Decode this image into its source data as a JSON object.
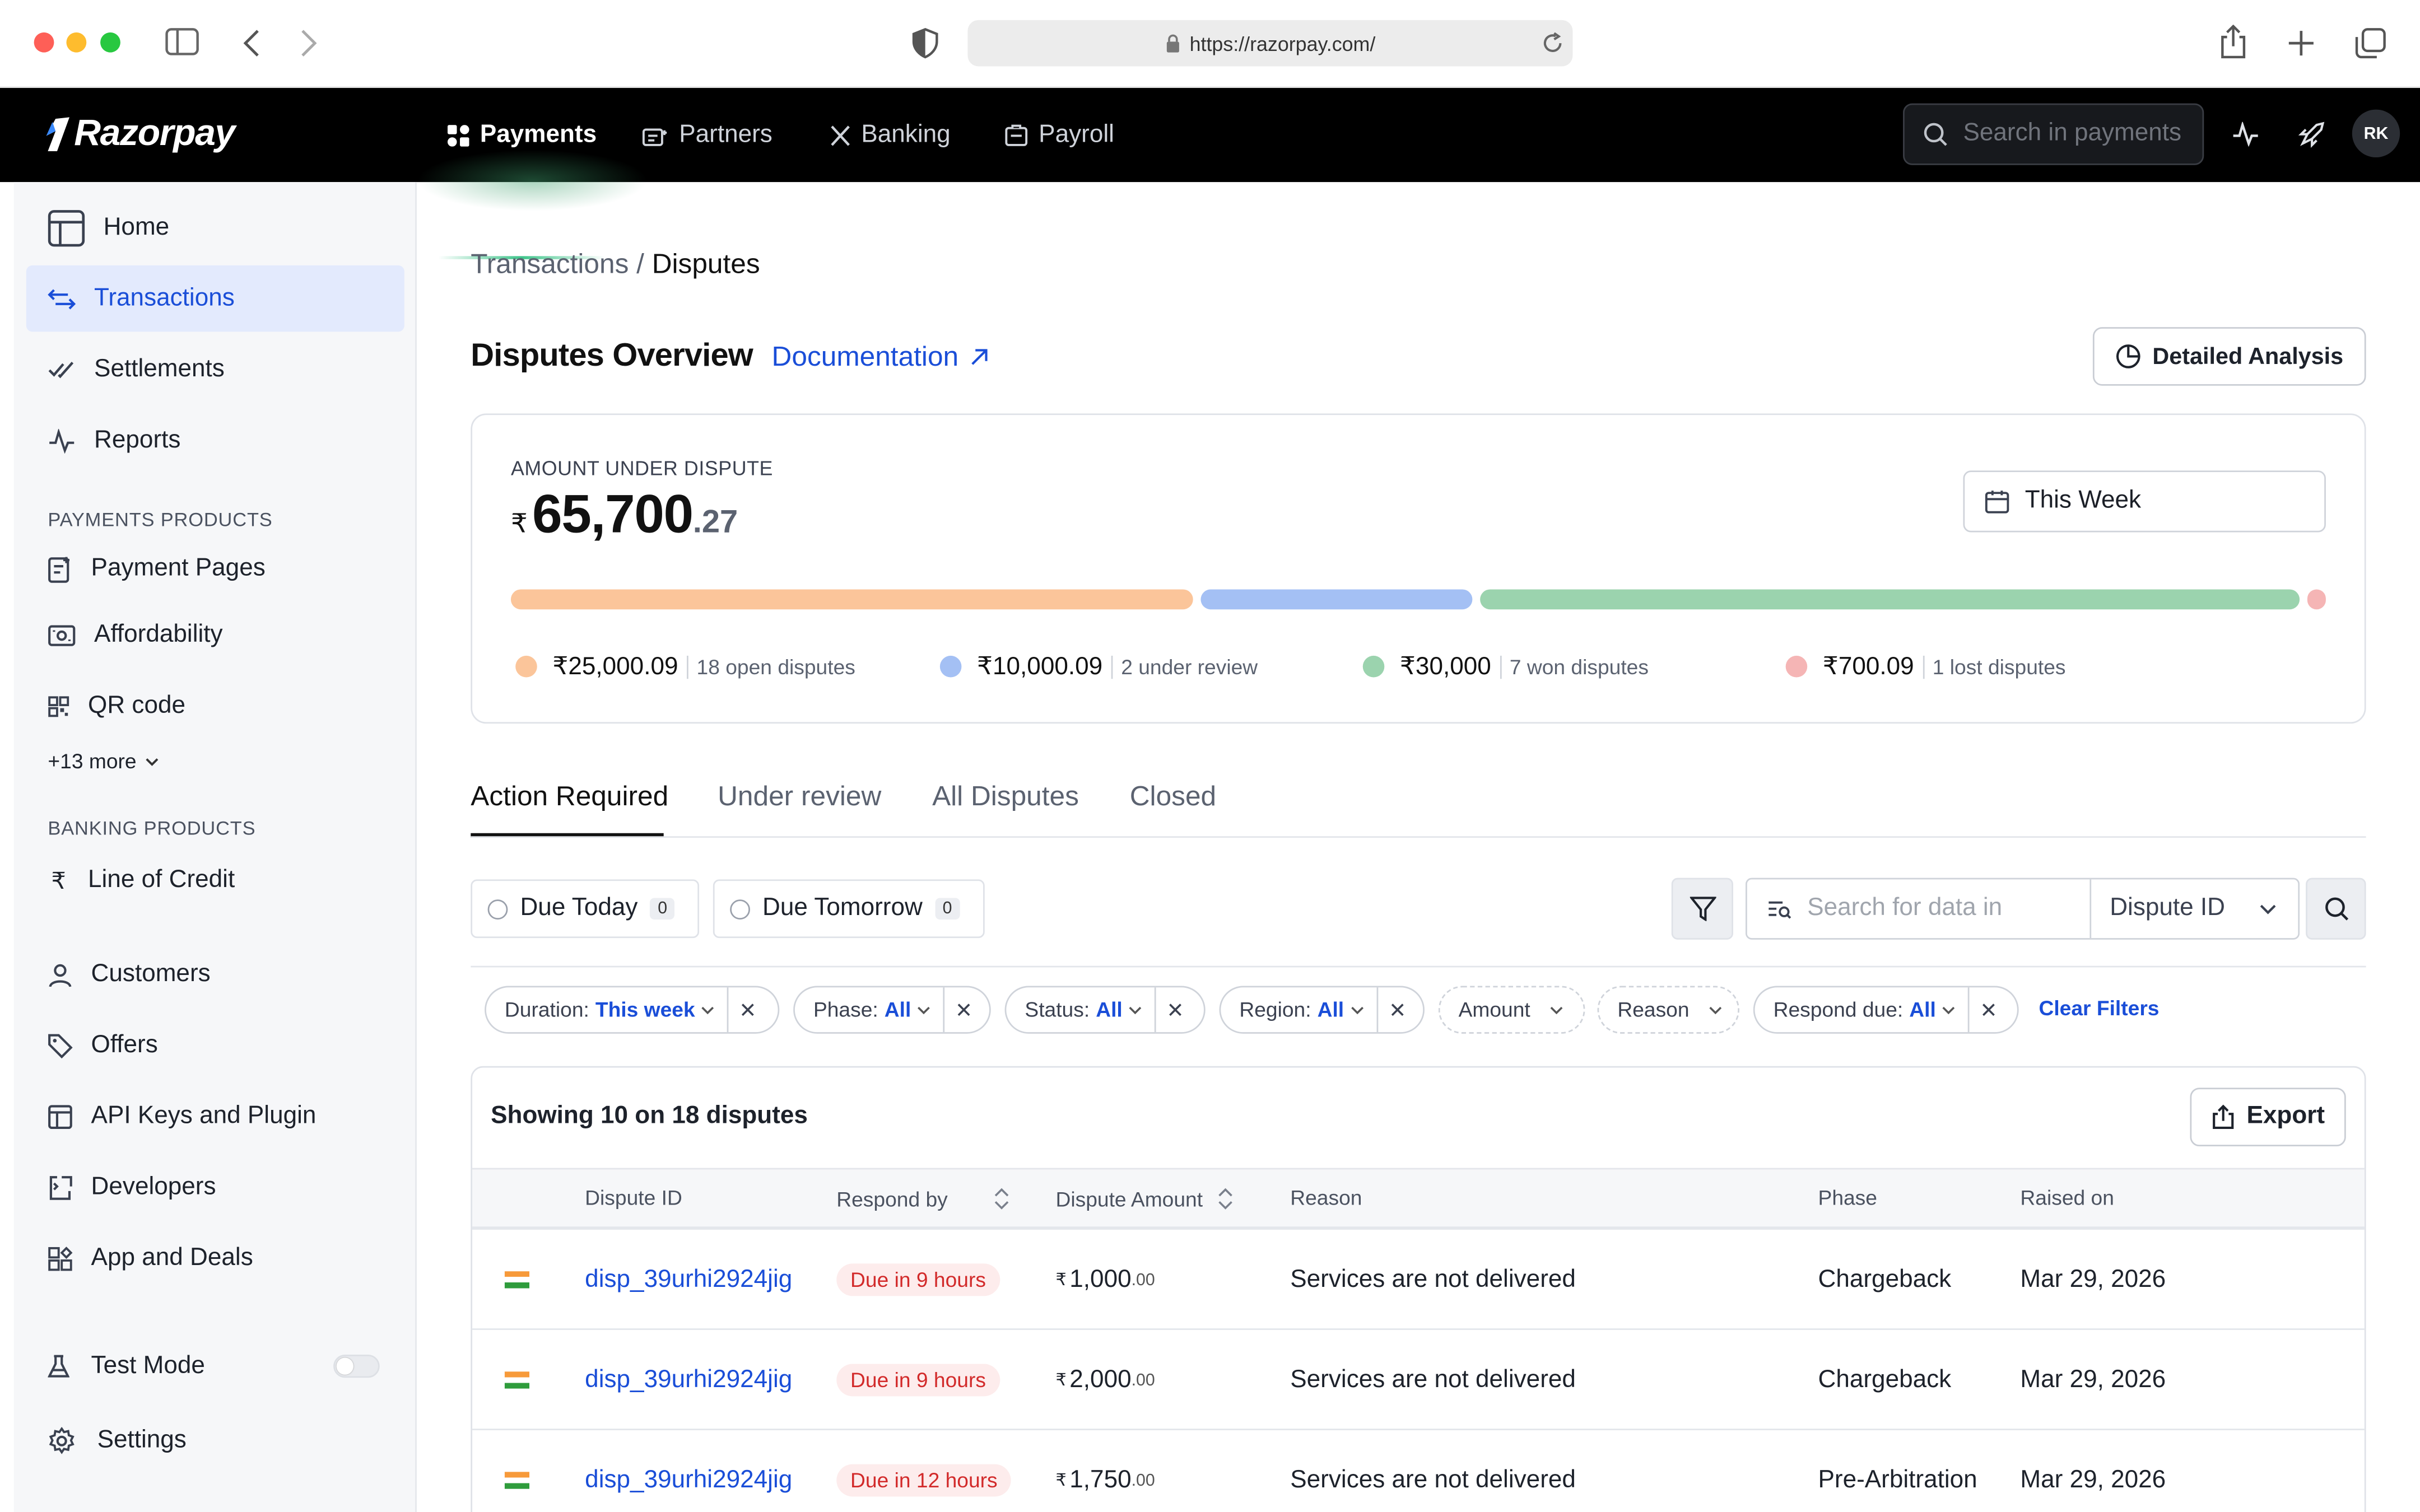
{
  "browser": {
    "url": "https://razorpay.com/"
  },
  "topnav": {
    "logo": "Razorpay",
    "items": [
      {
        "label": "Payments",
        "icon": "grid-icon"
      },
      {
        "label": "Partners",
        "icon": "partners-icon"
      },
      {
        "label": "Banking",
        "icon": "banking-icon"
      },
      {
        "label": "Payroll",
        "icon": "payroll-icon"
      }
    ],
    "search_placeholder": "Search in payments",
    "avatar": "RK"
  },
  "sidebar": {
    "items": [
      {
        "label": "Home"
      },
      {
        "label": "Transactions"
      },
      {
        "label": "Settlements"
      },
      {
        "label": "Reports"
      }
    ],
    "payments_heading": "PAYMENTS PRODUCTS",
    "payments_items": [
      {
        "label": "Payment Pages"
      },
      {
        "label": "Affordability"
      },
      {
        "label": "QR code"
      }
    ],
    "more": "+13 more",
    "banking_heading": "BANKING PRODUCTS",
    "banking_items": [
      {
        "label": "Line of Credit"
      }
    ],
    "other_items": [
      {
        "label": "Customers"
      },
      {
        "label": "Offers"
      },
      {
        "label": "API Keys and Plugin"
      },
      {
        "label": "Developers"
      },
      {
        "label": "App and Deals"
      }
    ],
    "test_mode": "Test Mode",
    "settings": "Settings"
  },
  "breadcrumb": {
    "parent": "Transactions",
    "sep": "/",
    "current": "Disputes"
  },
  "header": {
    "title": "Disputes Overview",
    "doc_link": "Documentation",
    "analysis_button": "Detailed Analysis"
  },
  "overview": {
    "label": "AMOUNT UNDER DISPUTE",
    "currency": "₹",
    "amount_main": "65,700",
    "amount_dec": ".27",
    "period": "This Week",
    "segments": [
      {
        "amount": "₹25,000.09",
        "count": "18 open disputes",
        "color": "#fbc59a",
        "share": 0.3805
      },
      {
        "amount": "₹10,000.09",
        "count": "2 under review",
        "color": "#a4c0f4",
        "share": 0.1522
      },
      {
        "amount": "₹30,000",
        "count": "7 won disputes",
        "color": "#9bd3ae",
        "share": 0.4566
      },
      {
        "amount": "₹700.09",
        "count": "1 lost disputes",
        "color": "#f5b5b5",
        "share": 0.0107
      }
    ]
  },
  "tabs": [
    "Action Required",
    "Under review",
    "All Disputes",
    "Closed"
  ],
  "quick_filters": [
    {
      "label": "Due Today",
      "count": "0"
    },
    {
      "label": "Due Tomorrow",
      "count": "0"
    }
  ],
  "search": {
    "placeholder": "Search for data in",
    "field": "Dispute ID"
  },
  "filters": [
    {
      "label": "Duration:",
      "value": "This week"
    },
    {
      "label": "Phase:",
      "value": "All"
    },
    {
      "label": "Status:",
      "value": "All"
    },
    {
      "label": "Region:",
      "value": "All"
    },
    {
      "label": "Amount",
      "value": ""
    },
    {
      "label": "Reason",
      "value": ""
    },
    {
      "label": "Respond due:",
      "value": "All"
    }
  ],
  "clear_filters": "Clear Filters",
  "table": {
    "showing": "Showing 10 on 18 disputes",
    "export": "Export",
    "columns": [
      "Dispute ID",
      "Respond by",
      "Dispute Amount",
      "Reason",
      "Phase",
      "Raised on"
    ],
    "rows": [
      {
        "id": "disp_39urhi2924jig",
        "due": "Due in 9 hours",
        "amount": "1,000",
        "dec": ".00",
        "reason": "Services are not delivered",
        "phase": "Chargeback",
        "date": "Mar 29, 2026"
      },
      {
        "id": "disp_39urhi2924jig",
        "due": "Due in 9 hours",
        "amount": "2,000",
        "dec": ".00",
        "reason": "Services are not delivered",
        "phase": "Chargeback",
        "date": "Mar 29, 2026"
      },
      {
        "id": "disp_39urhi2924jig",
        "due": "Due in 12 hours",
        "amount": "1,750",
        "dec": ".00",
        "reason": "Services are not delivered",
        "phase": "Pre-Arbitration",
        "date": "Mar 29, 2026"
      }
    ]
  }
}
